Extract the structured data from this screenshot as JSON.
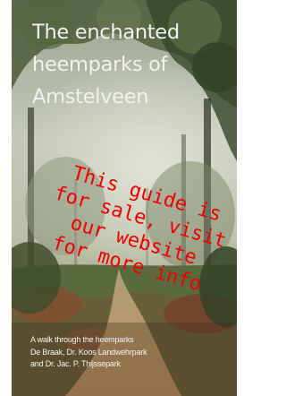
{
  "cover": {
    "title_lines": [
      "The enchanted",
      "heemparks of",
      "Amstelveen"
    ],
    "subtitle_lines": [
      "A walk through the heemparks",
      "De Braak, Dr. Koos Landwehrpark",
      "and Dr. Jac. P. Thijssepark"
    ]
  },
  "watermark": {
    "lines": [
      "This guide is",
      "for sale, visit",
      "our website",
      "for more info"
    ],
    "color": "#f00000"
  },
  "colors": {
    "sky": "#c8ccbe",
    "foliage_dark": "#3a4a2c",
    "path": "#c49c6a",
    "ground_red": "#8a4a30"
  }
}
